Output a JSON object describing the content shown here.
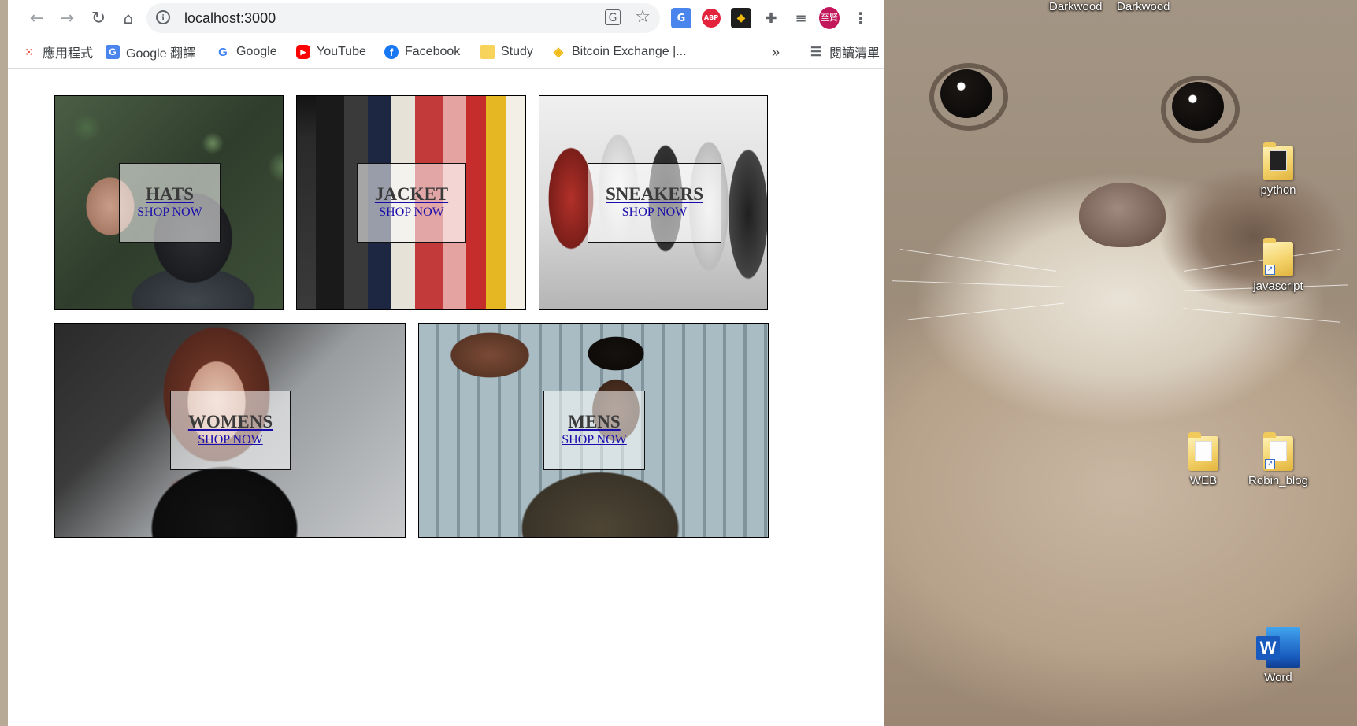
{
  "browser": {
    "url": "localhost:3000",
    "profile_initials": "至賢",
    "bookmarks": [
      {
        "label": "應用程式",
        "icon": "apps-grid-icon"
      },
      {
        "label": "Google 翻譯",
        "icon": "google-translate-icon"
      },
      {
        "label": "Google",
        "icon": "google-icon"
      },
      {
        "label": "YouTube",
        "icon": "youtube-icon"
      },
      {
        "label": "Facebook",
        "icon": "facebook-icon"
      },
      {
        "label": "Study",
        "icon": "folder-icon"
      },
      {
        "label": "Bitcoin Exchange |...",
        "icon": "binance-icon"
      }
    ],
    "more_bookmarks": "»",
    "reading_list": "閱讀清單",
    "extensions": {
      "abp": "ABP"
    }
  },
  "shop": {
    "categories": [
      {
        "title": "HATS",
        "subtitle": "SHOP NOW"
      },
      {
        "title": "JACKET",
        "subtitle": "SHOP NOW"
      },
      {
        "title": "SNEAKERS",
        "subtitle": "SHOP NOW"
      },
      {
        "title": "WOMENS",
        "subtitle": "SHOP NOW"
      },
      {
        "title": "MENS",
        "subtitle": "SHOP NOW"
      }
    ]
  },
  "desktop": {
    "top_labels": [
      "Darkwood",
      "Darkwood"
    ],
    "icons": [
      {
        "label": "python"
      },
      {
        "label": "javascript"
      },
      {
        "label": "WEB"
      },
      {
        "label": "Robin_blog"
      },
      {
        "label": "Word"
      }
    ]
  },
  "colors": {
    "link_blue": "#1a0dab",
    "profile_bg": "#c2185b"
  }
}
